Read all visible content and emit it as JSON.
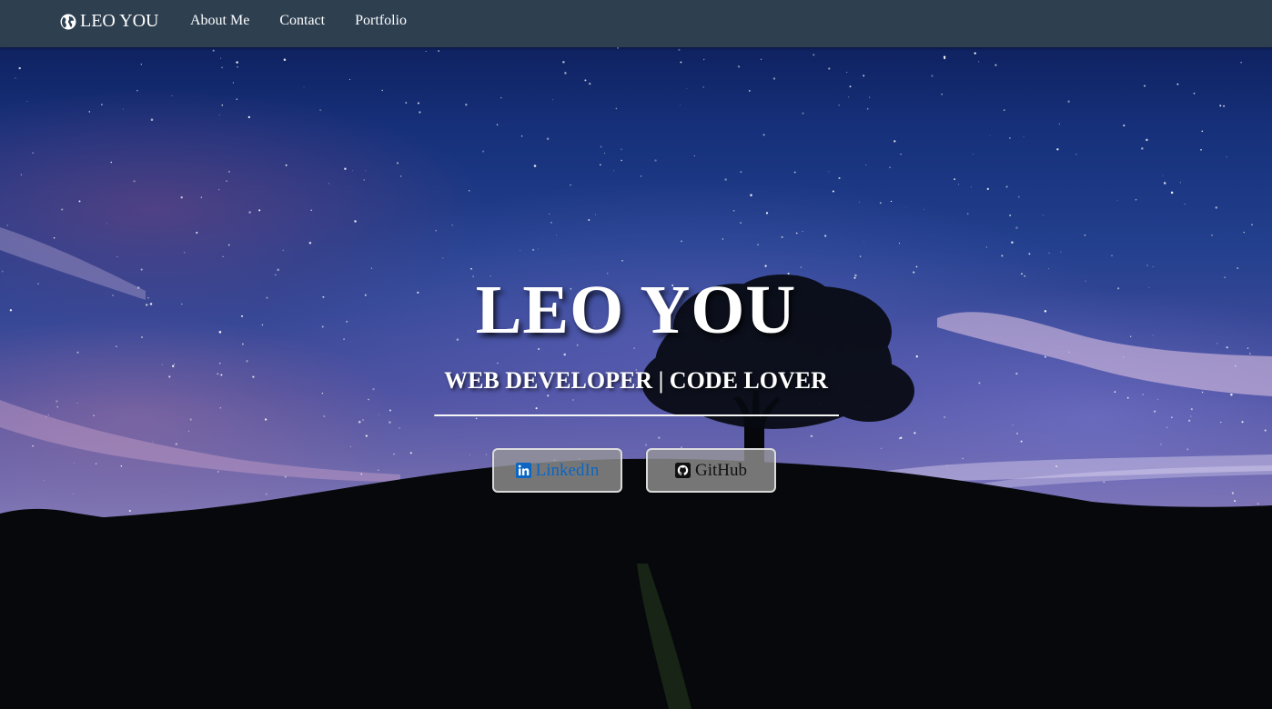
{
  "nav": {
    "brand_label": "LEO YOU",
    "brand_icon": "globe-icon",
    "links": [
      {
        "label": "About Me"
      },
      {
        "label": "Contact"
      },
      {
        "label": "Portfolio"
      }
    ]
  },
  "hero": {
    "title": "LEO YOU",
    "subtitle": "WEB DEVELOPER | CODE LOVER",
    "buttons": {
      "linkedin": {
        "label": "LinkedIn",
        "icon": "linkedin-icon"
      },
      "github": {
        "label": "GitHub",
        "icon": "github-icon"
      }
    }
  },
  "colors": {
    "navbar": "#2e3f50",
    "text": "#ffffff",
    "linkedin": "#0a66c2",
    "github": "#111111"
  }
}
